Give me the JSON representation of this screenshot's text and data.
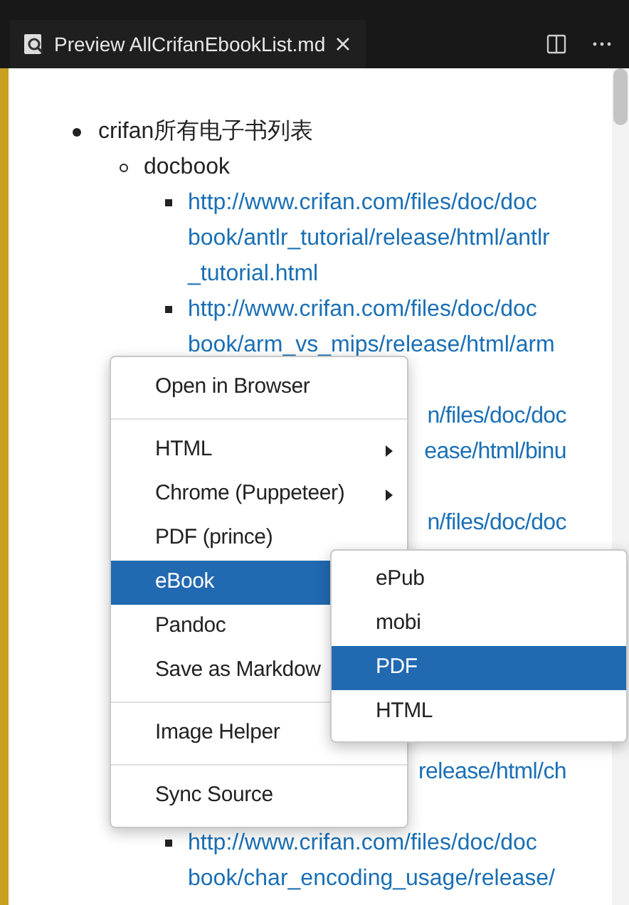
{
  "tab": {
    "title": "Preview AllCrifanEbookList.md"
  },
  "preview": {
    "lines": [
      {
        "kind": "bullet",
        "text": "crifan所有电子书列表"
      },
      {
        "kind": "circle",
        "text": "docbook"
      },
      {
        "kind": "link-start",
        "text": "http://www.crifan.com/files/doc/doc"
      },
      {
        "kind": "link",
        "text": "book/antlr_tutorial/release/html/antlr"
      },
      {
        "kind": "link",
        "text": "_tutorial.html"
      },
      {
        "kind": "link-start",
        "text": "http://www.crifan.com/files/doc/doc"
      },
      {
        "kind": "link",
        "text": "book/arm_vs_mips/release/html/arm"
      },
      {
        "kind": "blank"
      },
      {
        "kind": "fragment",
        "text": "n/files/doc/doc"
      },
      {
        "kind": "fragment",
        "text": "ease/html/binu"
      },
      {
        "kind": "blank"
      },
      {
        "kind": "fragment",
        "text": "n/files/doc/doc"
      },
      {
        "kind": "blank"
      },
      {
        "kind": "blank"
      },
      {
        "kind": "blank"
      },
      {
        "kind": "blank"
      },
      {
        "kind": "blank"
      },
      {
        "kind": "blank"
      },
      {
        "kind": "fragment",
        "text": "release/html/ch"
      },
      {
        "kind": "blank"
      },
      {
        "kind": "link-start",
        "text": "http://www.crifan.com/files/doc/doc"
      },
      {
        "kind": "link",
        "text": "book/char_encoding_usage/release/"
      }
    ]
  },
  "context_menu": {
    "items": [
      {
        "kind": "item",
        "label": "Open in Browser",
        "selected": false
      },
      {
        "kind": "separator"
      },
      {
        "kind": "submenu",
        "label": "HTML",
        "selected": false
      },
      {
        "kind": "submenu",
        "label": "Chrome (Puppeteer)",
        "selected": false
      },
      {
        "kind": "item",
        "label": "PDF (prince)",
        "selected": false
      },
      {
        "kind": "item",
        "label": "eBook",
        "selected": true
      },
      {
        "kind": "item",
        "label": "Pandoc",
        "selected": false
      },
      {
        "kind": "item",
        "label": "Save as Markdow",
        "selected": false
      },
      {
        "kind": "separator"
      },
      {
        "kind": "item",
        "label": "Image Helper",
        "selected": false
      },
      {
        "kind": "separator"
      },
      {
        "kind": "item",
        "label": "Sync Source",
        "selected": false
      }
    ]
  },
  "submenu": {
    "items": [
      {
        "label": "ePub",
        "selected": false
      },
      {
        "label": "mobi",
        "selected": false
      },
      {
        "label": "PDF",
        "selected": true
      },
      {
        "label": "HTML",
        "selected": false
      }
    ]
  }
}
